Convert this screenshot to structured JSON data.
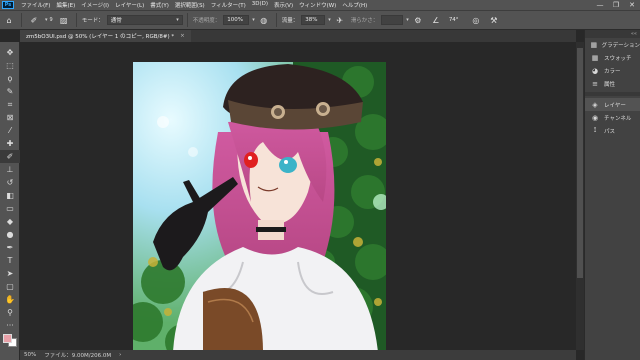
{
  "app": {
    "logo": "Ps"
  },
  "menu": [
    "ファイル(F)",
    "編集(E)",
    "イメージ(I)",
    "レイヤー(L)",
    "書式(Y)",
    "選択範囲(S)",
    "フィルター(T)",
    "3D(D)",
    "表示(V)",
    "ウィンドウ(W)",
    "ヘルプ(H)"
  ],
  "window_controls": {
    "minimize": "—",
    "maximize": "❐",
    "close": "✕"
  },
  "options": {
    "brush_size": "9",
    "mode_label": "モード：",
    "mode_value": "通常",
    "opacity_label": "不透明度：",
    "opacity_value": "100%",
    "flow_label": "流量：",
    "flow_value": "38%",
    "smoothing_label": "滑らかさ：",
    "smoothing_value": "",
    "angle_value": "74°"
  },
  "document": {
    "tab_title": "zm5bO3Ul.psd @ 50% (レイヤー 1 のコピー, RGB/8#) *",
    "close": "×"
  },
  "status": {
    "zoom": "50%",
    "file_info": "ファイル：9.00M/206.0M",
    "arrow": "›"
  },
  "panels": [
    {
      "label": "グラデーション",
      "icon": "gradient-icon",
      "glyph": "▦"
    },
    {
      "label": "スウォッチ",
      "icon": "swatches-icon",
      "glyph": "▦"
    },
    {
      "label": "カラー",
      "icon": "color-icon",
      "glyph": "◕"
    },
    {
      "label": "属性",
      "icon": "properties-icon",
      "glyph": "≡"
    },
    {
      "label": "レイヤー",
      "icon": "layers-icon",
      "glyph": "◈"
    },
    {
      "label": "チャンネル",
      "icon": "channels-icon",
      "glyph": "◉"
    },
    {
      "label": "パス",
      "icon": "paths-icon",
      "glyph": "⟟"
    }
  ],
  "tools": [
    {
      "name": "move-tool-icon",
      "glyph": "✥"
    },
    {
      "name": "marquee-tool-icon",
      "glyph": "⬚"
    },
    {
      "name": "lasso-tool-icon",
      "glyph": "ϙ"
    },
    {
      "name": "quick-select-tool-icon",
      "glyph": "✎"
    },
    {
      "name": "crop-tool-icon",
      "glyph": "⌗"
    },
    {
      "name": "frame-tool-icon",
      "glyph": "⊠"
    },
    {
      "name": "eyedropper-tool-icon",
      "glyph": "⁄"
    },
    {
      "name": "healing-tool-icon",
      "glyph": "✚"
    },
    {
      "name": "brush-tool-icon",
      "glyph": "✐"
    },
    {
      "name": "stamp-tool-icon",
      "glyph": "⊥"
    },
    {
      "name": "history-brush-tool-icon",
      "glyph": "↺"
    },
    {
      "name": "eraser-tool-icon",
      "glyph": "◧"
    },
    {
      "name": "gradient-tool-icon",
      "glyph": "▭"
    },
    {
      "name": "blur-tool-icon",
      "glyph": "◆"
    },
    {
      "name": "dodge-tool-icon",
      "glyph": "●"
    },
    {
      "name": "pen-tool-icon",
      "glyph": "✒"
    },
    {
      "name": "type-tool-icon",
      "glyph": "T"
    },
    {
      "name": "path-select-tool-icon",
      "glyph": "➤"
    },
    {
      "name": "shape-tool-icon",
      "glyph": "▢"
    },
    {
      "name": "hand-tool-icon",
      "glyph": "✋"
    },
    {
      "name": "zoom-tool-icon",
      "glyph": "⚲"
    },
    {
      "name": "more-tools-icon",
      "glyph": "···"
    }
  ],
  "active_tool": "brush-tool-icon",
  "colors": {
    "foreground": "#e8a0a8",
    "background": "#ffffff",
    "accent": "#31a8ff"
  }
}
